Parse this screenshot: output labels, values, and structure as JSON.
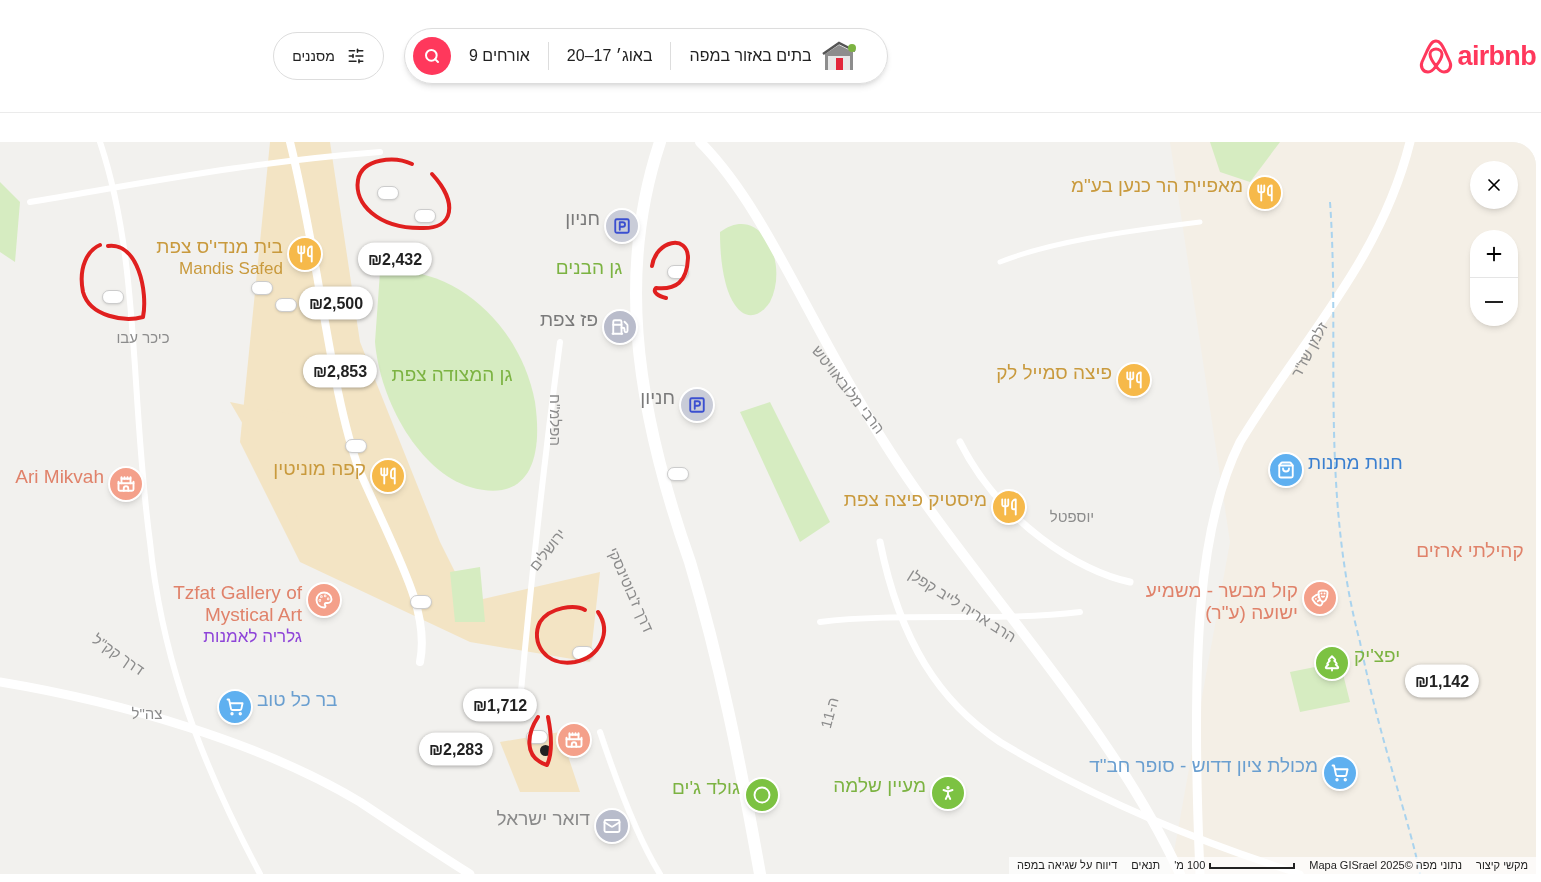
{
  "header": {
    "logo": "airbnb",
    "search": {
      "location": "בתים באזור במפה",
      "dates": "20–17 באוג׳",
      "guests": "9 אורחים"
    },
    "filters": "מסננים"
  },
  "map": {
    "price_pins": [
      {
        "label": "₪2,432"
      },
      {
        "label": "₪2,500"
      },
      {
        "label": "₪2,853"
      },
      {
        "label": "₪1,712"
      },
      {
        "label": "₪2,283"
      },
      {
        "label": "₪1,142"
      }
    ],
    "places": [
      {
        "name": "בית מנדי'ס צפת",
        "secondary_name": "Mandis Safed",
        "kind": "food"
      },
      {
        "name": "מאפיית הר כנען בע\"מ",
        "kind": "food"
      },
      {
        "name": "חניון",
        "kind": "parking"
      },
      {
        "name": "פז צפת",
        "kind": "gas"
      },
      {
        "name": "חניון",
        "kind": "parking"
      },
      {
        "name": "פיצה סמייל לק",
        "kind": "food"
      },
      {
        "name": "קפה מוניטין",
        "kind": "food"
      },
      {
        "name": "Ari Mikvah",
        "kind": "landmark"
      },
      {
        "name": "חנות מתנות",
        "kind": "gift"
      },
      {
        "name": "מיסטיק פיצה צפת",
        "kind": "food"
      },
      {
        "name": "קול מבשר - משמיע ישועה (ע\"ר)",
        "kind": "theater"
      },
      {
        "name": "Tzfat Gallery of Mystical Art",
        "secondary_name": "גלריה לאמנות",
        "kind": "art"
      },
      {
        "name": "יפצ'יק",
        "kind": "tree"
      },
      {
        "name": "בר כל טוב",
        "kind": "shop"
      },
      {
        "kind": "landmark"
      },
      {
        "name": "מכולת ציון דדוש - סופר חב\"ד",
        "kind": "shop"
      },
      {
        "name": "מעיין שלמה",
        "kind": "hiking"
      },
      {
        "name": "גולד ג'ים",
        "kind": "gym"
      },
      {
        "name": "דואר ישראל",
        "kind": "post"
      }
    ],
    "labels": [
      {
        "text": "כיכר עבו",
        "kind": "street"
      },
      {
        "text": "גן המצודה צפת",
        "kind": "park"
      },
      {
        "text": "גן הבנים",
        "kind": "park"
      },
      {
        "text": "הרבי מלובאוויטש",
        "kind": "street"
      },
      {
        "text": "זלמן שז\"ר",
        "kind": "street"
      },
      {
        "text": "הרב אריה לייב קפלן",
        "kind": "street"
      },
      {
        "text": "הפלמ\"ח",
        "kind": "street"
      },
      {
        "text": "יוספטל",
        "kind": "street"
      },
      {
        "text": "דרך ז'בוטינסקי",
        "kind": "street"
      },
      {
        "text": "דרך קק\"ל",
        "kind": "street"
      },
      {
        "text": "צה\"ל",
        "kind": "street"
      },
      {
        "text": "ירושלים",
        "kind": "street"
      },
      {
        "text": "ה-11",
        "kind": "street"
      },
      {
        "text": "קהילתי ארזים",
        "kind": "place"
      }
    ],
    "attribution": {
      "shortcuts": "מקשי קיצור",
      "data": "נתוני מפה ©2025 Mapa GISrael",
      "scale": "100 מ'",
      "terms": "תנאים",
      "report": "דיווח על שגיאה במפה"
    }
  }
}
